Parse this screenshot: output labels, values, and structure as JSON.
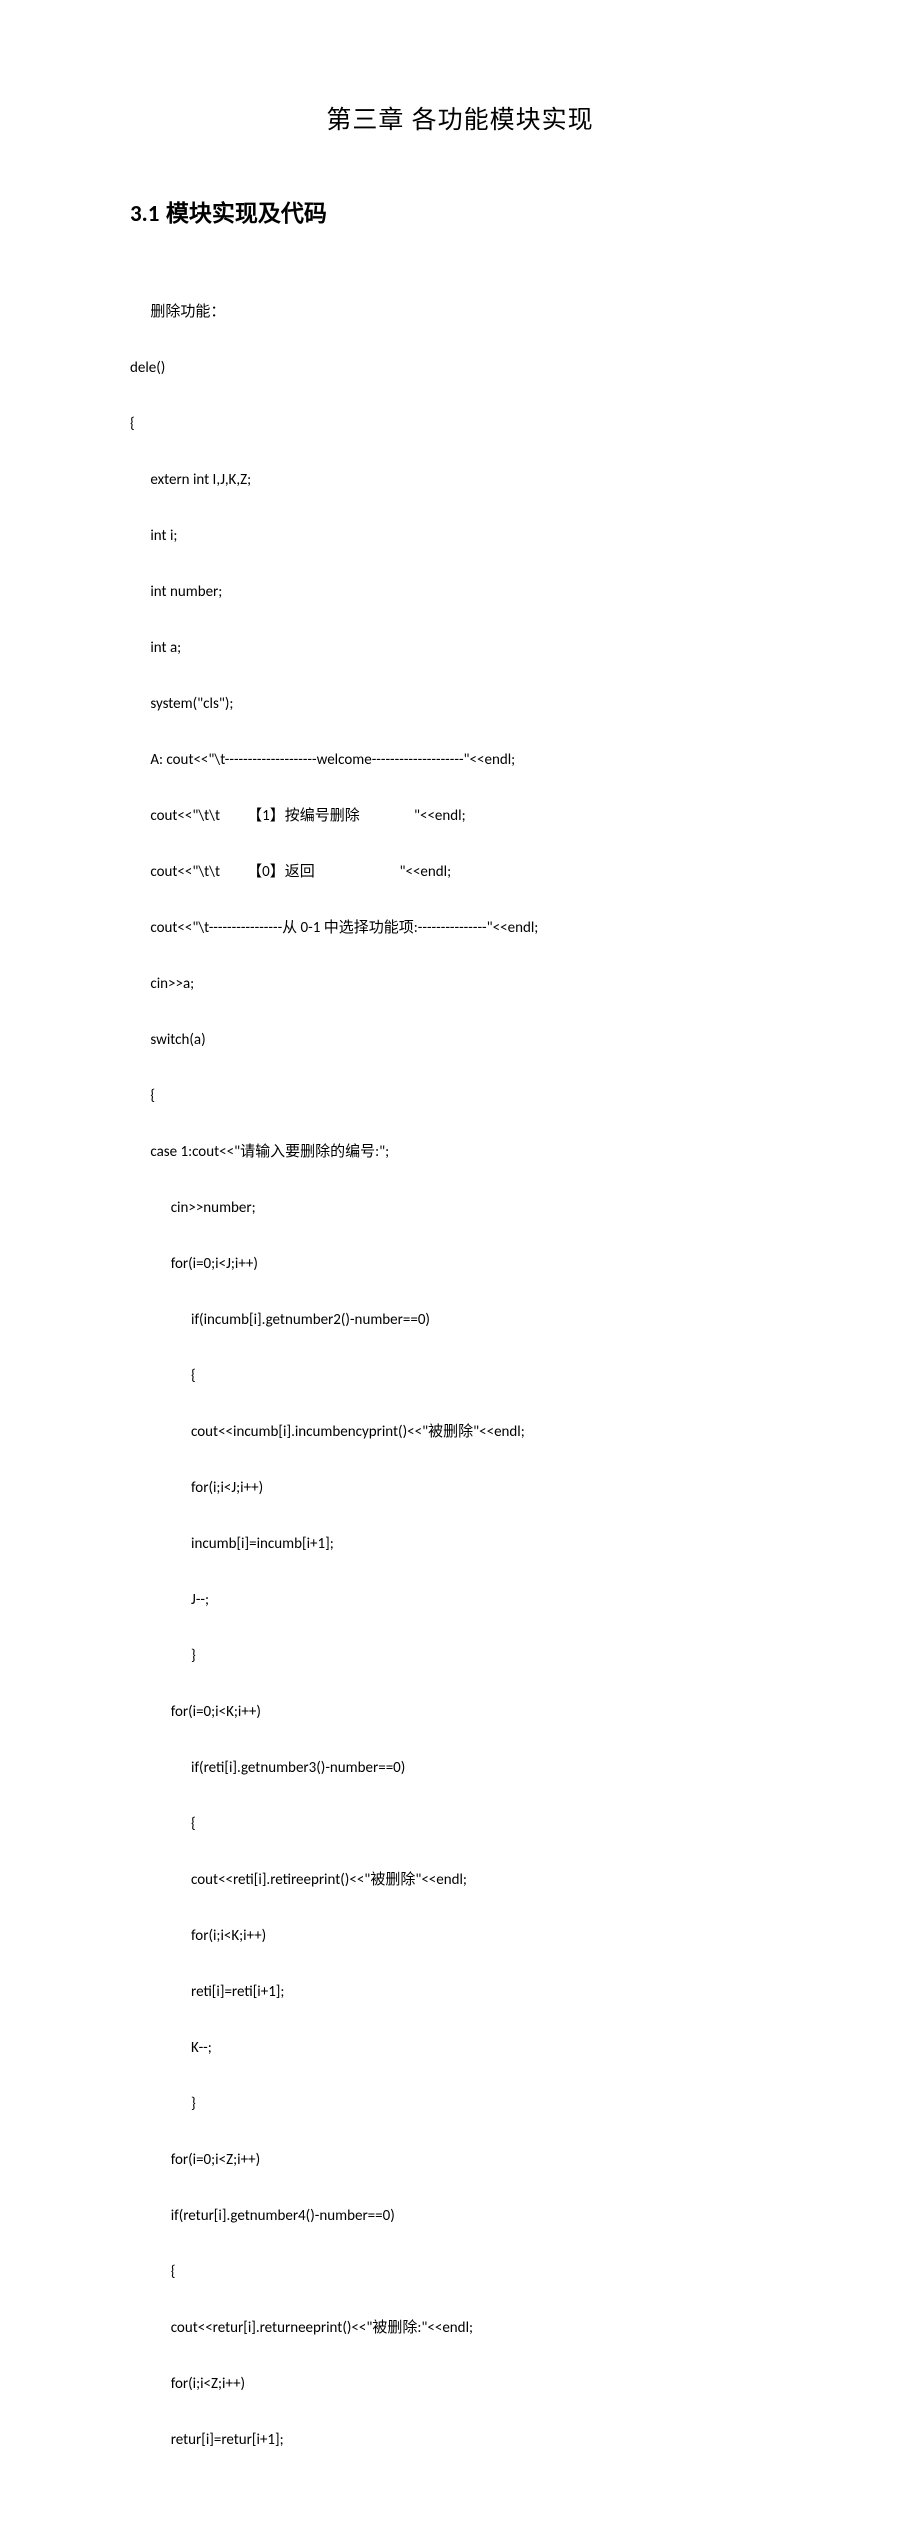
{
  "chapter": {
    "title": "第三章  各功能模块实现"
  },
  "section": {
    "number": "3.1",
    "title": "模块实现及代码"
  },
  "code": {
    "l1": "      删除功能：",
    "l2": "dele()",
    "l3": "{",
    "l4": "      extern int I,J,K,Z;",
    "l5": "      int i;",
    "l6": "      int number;",
    "l7": "      int a;",
    "l8": "      system(\"cls\");",
    "l9": "      A: cout<<\"\\t--------------------welcome--------------------\"<<endl;",
    "l10": "      cout<<\"\\t\\t        【1】按编号删除                \"<<endl;",
    "l11": "      cout<<\"\\t\\t        【0】返回                         \"<<endl;",
    "l12": "      cout<<\"\\t----------------从 0-1 中选择功能项:---------------\"<<endl;",
    "l13": "      cin>>a;",
    "l14": "      switch(a)",
    "l15": "      {",
    "l16": "      case 1:cout<<\"请输入要删除的编号:\";",
    "l17": "            cin>>number;",
    "l18": "            for(i=0;i<J;i++)",
    "l19": "                  if(incumb[i].getnumber2()-number==0)",
    "l20": "                  {",
    "l21": "                  cout<<incumb[i].incumbencyprint()<<\"被删除\"<<endl;",
    "l22": "                  for(i;i<J;i++)",
    "l23": "                  incumb[i]=incumb[i+1];",
    "l24": "                  J--;",
    "l25": "                  }",
    "l26": "            for(i=0;i<K;i++)",
    "l27": "                  if(reti[i].getnumber3()-number==0)",
    "l28": "                  {",
    "l29": "                  cout<<reti[i].retireeprint()<<\"被删除\"<<endl;",
    "l30": "                  for(i;i<K;i++)",
    "l31": "                  reti[i]=reti[i+1];",
    "l32": "                  K--;",
    "l33": "                  }",
    "l34": "            for(i=0;i<Z;i++)",
    "l35": "            if(retur[i].getnumber4()-number==0)",
    "l36": "            {",
    "l37": "            cout<<retur[i].returneeprint()<<\"被删除:\"<<endl;",
    "l38": "            for(i;i<Z;i++)",
    "l39": "            retur[i]=retur[i+1];"
  }
}
